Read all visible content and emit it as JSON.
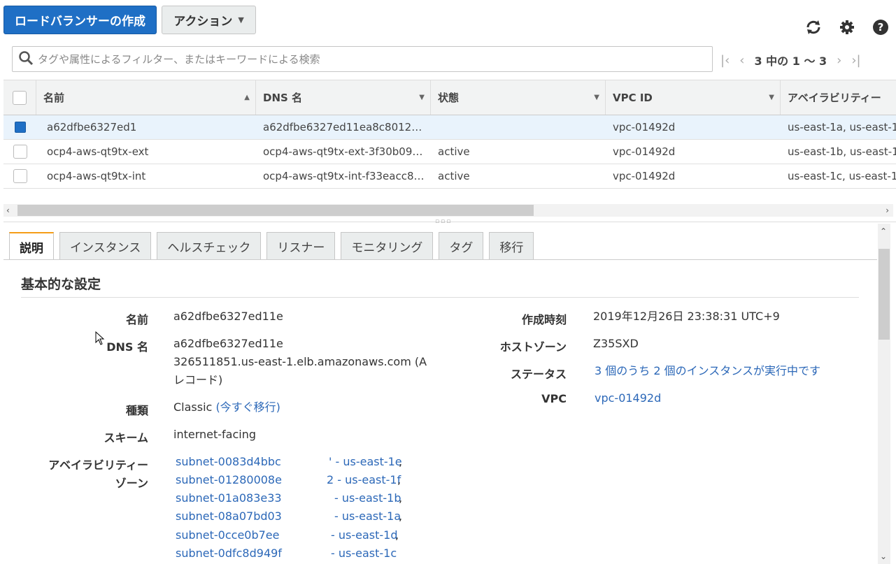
{
  "toolbar": {
    "create_label": "ロードバランサーの作成",
    "actions_label": "アクション",
    "refresh_icon": "refresh-icon",
    "settings_icon": "gear-icon",
    "help_icon": "help-icon"
  },
  "search": {
    "placeholder": "タグや属性によるフィルター、またはキーワードによる検索"
  },
  "pager": {
    "text": "3 中の 1 ～ 3"
  },
  "grid": {
    "columns": [
      "名前",
      "DNS 名",
      "状態",
      "VPC ID",
      "アベイラビリティー"
    ],
    "rows": [
      {
        "name": "a62dfbe6327ed1",
        "dns": "a62dfbe6327ed11ea8c8012…",
        "state": "",
        "vpc": "vpc-01492d",
        "az": "us-east-1a, us-east-1",
        "selected": true
      },
      {
        "name": "ocp4-aws-qt9tx-ext",
        "dns": "ocp4-aws-qt9tx-ext-3f30b09…",
        "state": "active",
        "vpc": "vpc-01492d",
        "az": "us-east-1b, us-east-1",
        "selected": false
      },
      {
        "name": "ocp4-aws-qt9tx-int",
        "dns": "ocp4-aws-qt9tx-int-f33eacc8…",
        "state": "active",
        "vpc": "vpc-01492d",
        "az": "us-east-1c, us-east-1",
        "selected": false
      }
    ]
  },
  "tabs": [
    "説明",
    "インスタンス",
    "ヘルスチェック",
    "リスナー",
    "モニタリング",
    "タグ",
    "移行"
  ],
  "detail": {
    "section_title": "基本的な設定",
    "left": {
      "name_label": "名前",
      "name_value": "a62dfbe6327ed11e",
      "dns_label": "DNS 名",
      "dns_value_1": "a62dfbe6327ed11e",
      "dns_value_2": "326511851.us-east-1.elb.amazonaws.com (A",
      "dns_value_3": "レコード)",
      "type_label": "種類",
      "type_value": "Classic",
      "type_link": "(今すぐ移行)",
      "scheme_label": "スキーム",
      "scheme_value": "internet-facing",
      "az_label_1": "アベイラビリティー",
      "az_label_2": "ゾーン",
      "subnets": [
        {
          "id": "subnet-0083d4bbc",
          "zone": "' - us-east-1e",
          "sep": ","
        },
        {
          "id": "subnet-01280008e",
          "zone": "2 - us-east-1f",
          "sep": ","
        },
        {
          "id": "subnet-01a083e33",
          "zone": "- us-east-1b",
          "sep": ","
        },
        {
          "id": "subnet-08a07bd03",
          "zone": "- us-east-1a",
          "sep": ","
        },
        {
          "id": "subnet-0cce0b7ee",
          "zone": "- us-east-1d",
          "sep": ","
        },
        {
          "id": "subnet-0dfc8d949f",
          "zone": "- us-east-1c",
          "sep": ""
        }
      ]
    },
    "right": {
      "created_label": "作成時刻",
      "created_value": "2019年12月26日 23:38:31 UTC+9",
      "zone_label": "ホストゾーン",
      "zone_value": "Z35SXD",
      "status_label": "ステータス",
      "status_value": "3 個のうち 2 個のインスタンスが実行中です",
      "vpc_label": "VPC",
      "vpc_value": "vpc-01492d"
    }
  }
}
